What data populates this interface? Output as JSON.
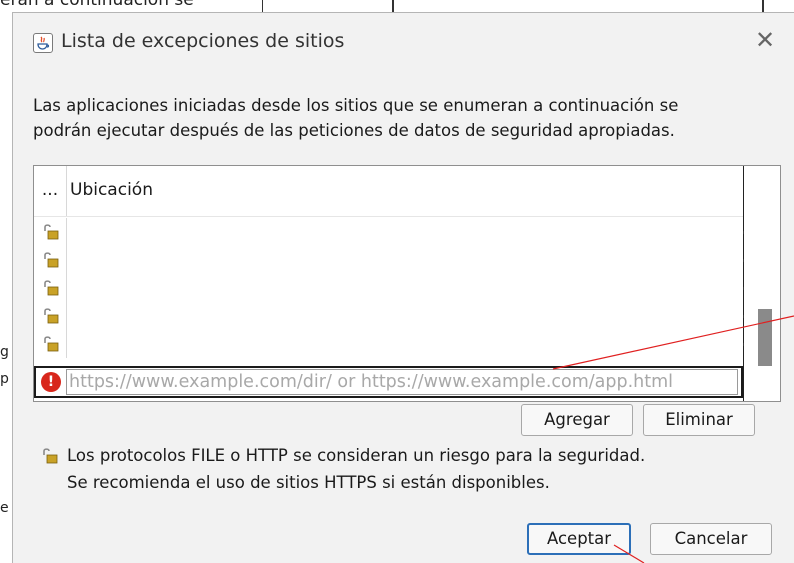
{
  "background": {
    "partial_text": "eran a continuación se",
    "frag_g": "g",
    "frag_p": "p",
    "frag_e": "e"
  },
  "dialog": {
    "title": "Lista de excepciones de sitios",
    "close_glyph": "✕",
    "description_line1": "Las aplicaciones iniciadas desde los sitios que se enumeran a continuación se",
    "description_line2": "podrán ejecutar después de las peticiones de datos de seguridad apropiadas."
  },
  "table": {
    "col_icon_header": "...",
    "col_location_header": "Ubicación",
    "rows": [
      {
        "icon": "unlocked-padlock-icon",
        "location": ""
      },
      {
        "icon": "unlocked-padlock-icon",
        "location": ""
      },
      {
        "icon": "unlocked-padlock-icon",
        "location": ""
      },
      {
        "icon": "unlocked-padlock-icon",
        "location": ""
      },
      {
        "icon": "unlocked-padlock-icon",
        "location": ""
      }
    ],
    "edit_row": {
      "icon": "error-icon",
      "error_glyph": "!",
      "value": "",
      "placeholder": "https://www.example.com/dir/ or https://www.example.com/app.html"
    }
  },
  "buttons": {
    "add": "Agregar",
    "remove": "Eliminar",
    "ok": "Aceptar",
    "cancel": "Cancelar"
  },
  "warning": {
    "line1": "Los protocolos FILE o HTTP se consideran un riesgo para la seguridad.",
    "line2": "Se recomienda el uso de sitios HTTPS si están disponibles."
  },
  "colors": {
    "dialog_bg": "#f2f2f2",
    "accent": "#2c6fb8",
    "error": "#d8271c",
    "annotation_line": "#e02020",
    "padlock": "#c9a227"
  }
}
